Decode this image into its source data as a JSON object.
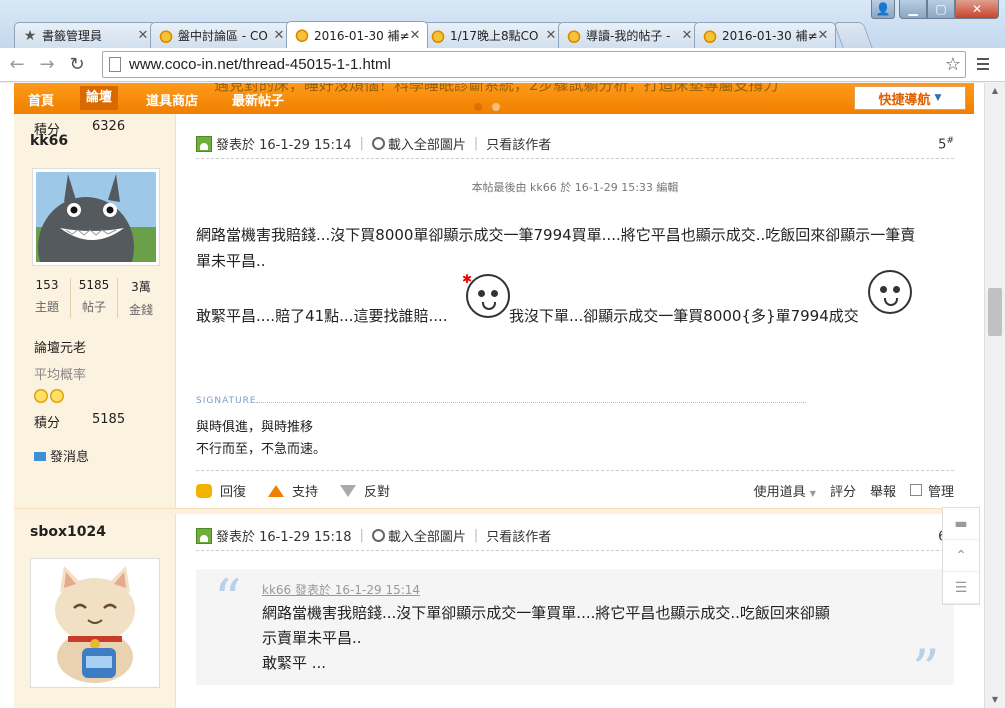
{
  "browser": {
    "tabs": [
      {
        "label": "書籤管理員",
        "icon": "star"
      },
      {
        "label": "盤中討論區 - CO",
        "icon": "coco"
      },
      {
        "label": "2016-01-30 補≠",
        "icon": "coco"
      },
      {
        "label": "1/17晚上8點CO",
        "icon": "coco"
      },
      {
        "label": "導讀-我的帖子 -",
        "icon": "coco"
      },
      {
        "label": "2016-01-30 補≠",
        "icon": "coco"
      }
    ],
    "url": "www.coco-in.net/thread-45015-1-1.html"
  },
  "forum_nav": {
    "items": [
      "首頁",
      "論壇",
      "道具商店",
      "最新帖子"
    ],
    "marquee": "遇見對的床，睡好沒煩惱！科學睡眠診斷系統，2步驟試躺分析，打造床墊專屬支撐力",
    "quick_nav": "快捷導航"
  },
  "post1": {
    "top_points_label": "積分",
    "top_points_value": "6326",
    "author": "kk66",
    "stats": [
      {
        "num": "153",
        "label": "主題"
      },
      {
        "num": "5185",
        "label": "帖子"
      },
      {
        "num": "3萬",
        "label": "金錢"
      }
    ],
    "rank": "論壇元老",
    "prob_label": "平均概率",
    "points_label": "積分",
    "points_value": "5185",
    "send_msg": "發消息",
    "posted": "發表於 16-1-29 15:14",
    "load_images": "載入全部圖片",
    "only_author": "只看該作者",
    "floor": "5",
    "edited": "本帖最後由 kk66 於 16-1-29 15:33 編輯",
    "msg_line1": "網路當機害我賠錢...沒下買8000單卻顯示成交一筆7994買單....將它平昌也顯示成交..吃飯回來卻顯示一筆賣",
    "msg_line2": "單未平昌..",
    "msg_line3a": "敢緊平昌....賠了41點...這要找誰賠....",
    "msg_line3b": "我沒下單...卻顯示成交一筆買8000{多}單7994成交",
    "sig_label": "SIGNATURE",
    "sig_line1": "與時俱進，與時推移",
    "sig_line2": "不行而至，不急而速。",
    "actions": {
      "reply": "回復",
      "support": "支持",
      "oppose": "反對",
      "tools": "使用道具",
      "rate": "評分",
      "report": "舉報",
      "manage": "管理"
    }
  },
  "post2": {
    "author": "sbox1024",
    "posted": "發表於 16-1-29 15:18",
    "load_images": "載入全部圖片",
    "only_author": "只看該作者",
    "floor": "6",
    "quote_head": "kk66 發表於 16-1-29 15:14",
    "quote_line1": "網路當機害我賠錢...沒下單卻顯示成交一筆買單....將它平昌也顯示成交..吃飯回來卻顯",
    "quote_line2": "示賣單未平昌..",
    "quote_line3": "敢緊平 ..."
  }
}
